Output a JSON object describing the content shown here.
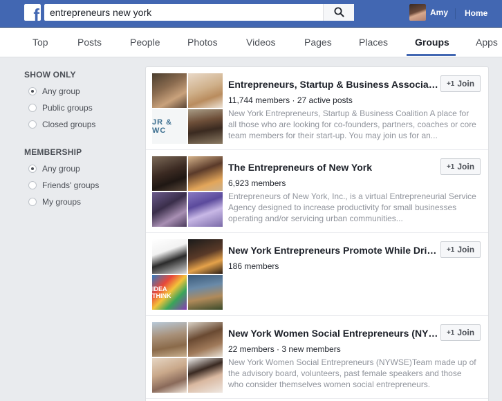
{
  "header": {
    "logo_glyph": "f",
    "search_value": "entrepreneurs new york",
    "search_icon": "search-icon",
    "user_name": "Amy",
    "home_label": "Home"
  },
  "tabs": [
    "Top",
    "Posts",
    "People",
    "Photos",
    "Videos",
    "Pages",
    "Places",
    "Groups",
    "Apps"
  ],
  "active_tab": "Groups",
  "filters": {
    "show_only": {
      "title": "SHOW ONLY",
      "options": [
        "Any group",
        "Public groups",
        "Closed groups"
      ],
      "selected": "Any group"
    },
    "membership": {
      "title": "MEMBERSHIP",
      "options": [
        "Any group",
        "Friends' groups",
        "My groups"
      ],
      "selected": "Any group"
    }
  },
  "results": [
    {
      "title": "Entrepreneurs, Startup & Business Association",
      "meta": "11,744 members · 27 active posts",
      "description": "New York Entrepreneurs, Startup & Business Coalition A place for all those who are looking for co-founders, partners, coaches or core team members for their start-up. You may join us for an...",
      "thumb_caption": "JR & WC",
      "join_label": "Join"
    },
    {
      "title": "The Entrepreneurs of New York",
      "meta": "6,923 members",
      "description": "Entrepreneurs of New York, Inc., is a virtual Entrepreneurial Service Agency designed to increase productivity for small businesses operating and/or servicing urban communities...",
      "join_label": "Join"
    },
    {
      "title": "New York Entrepreneurs Promote While Drinking",
      "meta": "186 members",
      "description": "",
      "thumb_caption": "IDEA THINK",
      "join_label": "Join"
    },
    {
      "title": "New York Women Social Entrepreneurs (NYWSE)",
      "meta": "22 members · 3 new members",
      "description": "New York Women Social Entrepreneurs (NYWSE)Team made up of the advisory board, volunteers, past female speakers and those who consider themselves women social entrepreneurs.",
      "join_label": "Join"
    }
  ],
  "colors": {
    "brand_blue": "#4267b2",
    "page_bg": "#e9ebee",
    "muted_text": "#90949c"
  }
}
